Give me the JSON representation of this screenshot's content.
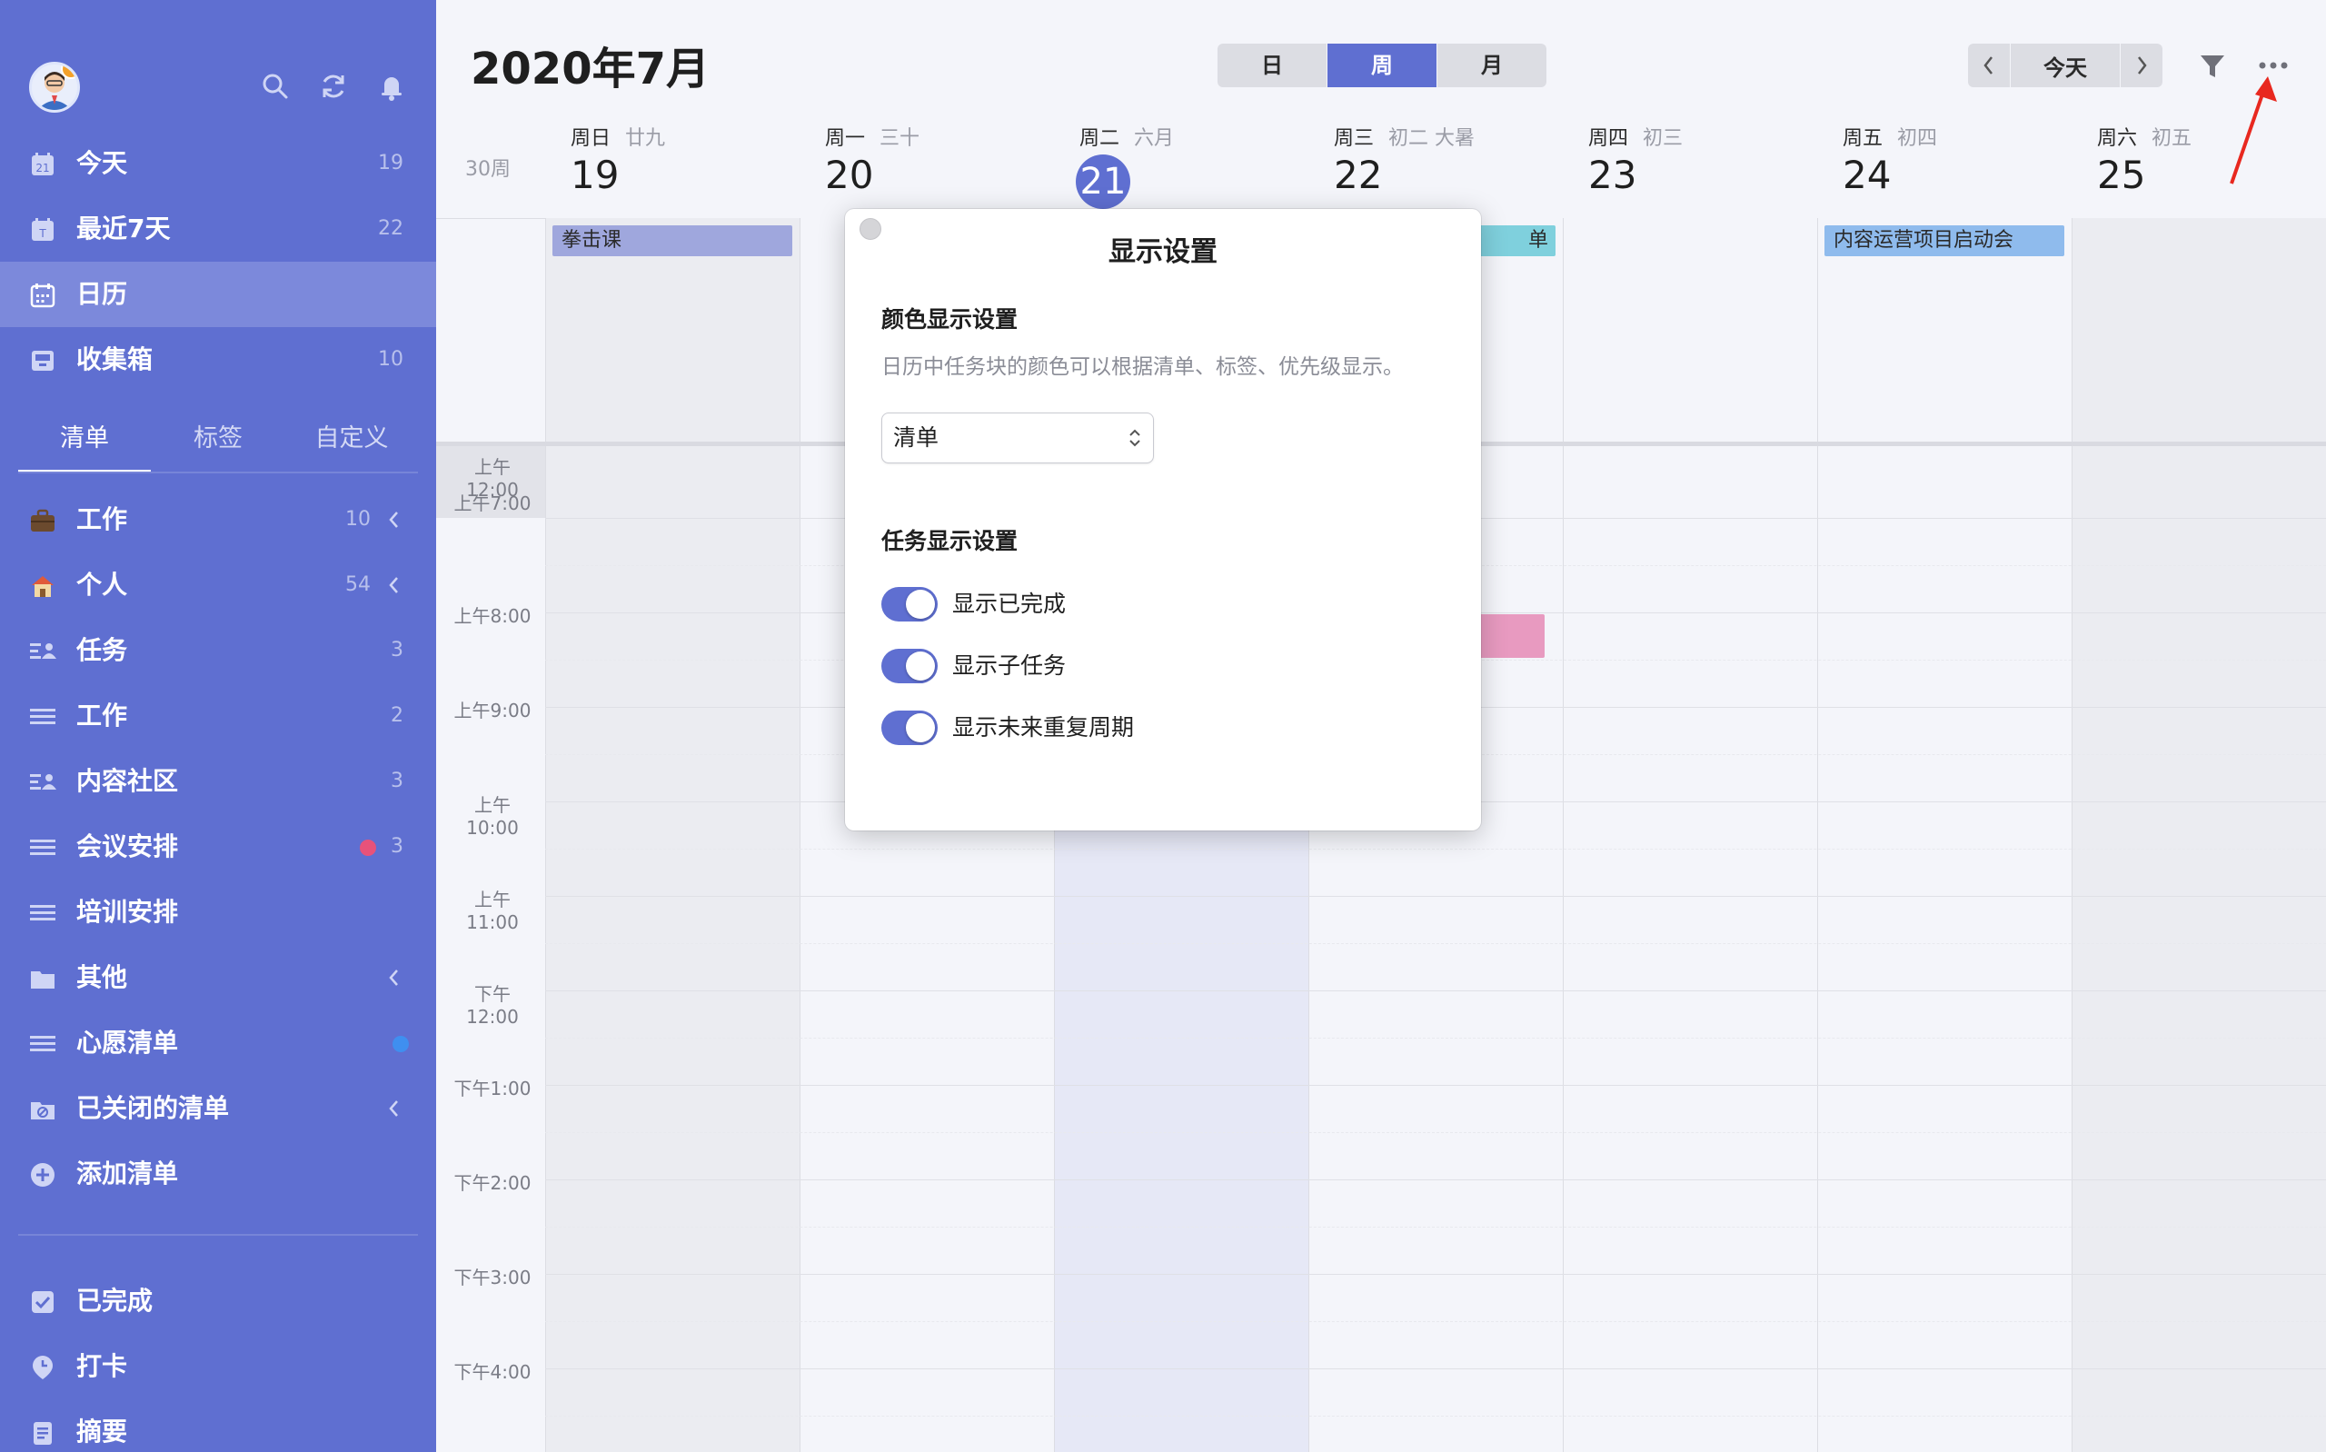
{
  "header": {
    "title": "2020年7月",
    "views": [
      "日",
      "周",
      "月"
    ],
    "active_view": "周",
    "today_label": "今天"
  },
  "sidebar": {
    "smart_lists": [
      {
        "label": "今天",
        "count": "19"
      },
      {
        "label": "最近7天",
        "count": "22"
      },
      {
        "label": "日历",
        "count": ""
      },
      {
        "label": "收集箱",
        "count": "10"
      }
    ],
    "tabs": [
      "清单",
      "标签",
      "自定义"
    ],
    "lists": [
      {
        "label": "工作",
        "count": "10"
      },
      {
        "label": "个人",
        "count": "54"
      },
      {
        "label": "任务",
        "count": "3"
      },
      {
        "label": "工作",
        "count": "2"
      },
      {
        "label": "内容社区",
        "count": "3"
      },
      {
        "label": "会议安排",
        "count": "3"
      },
      {
        "label": "培训安排",
        "count": ""
      },
      {
        "label": "其他",
        "count": ""
      },
      {
        "label": "心愿清单",
        "count": ""
      },
      {
        "label": "已关闭的清单",
        "count": ""
      },
      {
        "label": "添加清单",
        "count": ""
      }
    ],
    "bottom": [
      {
        "label": "已完成"
      },
      {
        "label": "打卡"
      },
      {
        "label": "摘要"
      }
    ],
    "colors": {
      "background": "#5f6fd1",
      "active": "#7c89db",
      "red_dot": "#e8527a",
      "blue_dot": "#3f8ff0"
    }
  },
  "calendar": {
    "week_label": "30周",
    "days": [
      {
        "dow": "周日",
        "lunar": "廿九",
        "num": "19"
      },
      {
        "dow": "周一",
        "lunar": "三十",
        "num": "20"
      },
      {
        "dow": "周二",
        "lunar": "六月",
        "num": "21"
      },
      {
        "dow": "周三",
        "lunar": "初二  大暑",
        "num": "22"
      },
      {
        "dow": "周四",
        "lunar": "初三",
        "num": "23"
      },
      {
        "dow": "周五",
        "lunar": "初四",
        "num": "24"
      },
      {
        "dow": "周六",
        "lunar": "初五",
        "num": "25"
      }
    ],
    "times": [
      "上午12:00",
      "上午7:00",
      "上午8:00",
      "上午9:00",
      "上午10:00",
      "上午11:00",
      "下午12:00",
      "下午1:00",
      "下午2:00",
      "下午3:00",
      "下午4:00"
    ],
    "events": [
      {
        "title": "拳击课",
        "color": "#9fa7dd"
      },
      {
        "title": "单",
        "color": "#7fd0dd"
      },
      {
        "title": "内容运营项目启动会",
        "color": "#8fbbed"
      },
      {
        "title": "",
        "color": "#e89ac0"
      }
    ]
  },
  "dialog": {
    "title": "显示设置",
    "color_section": "颜色显示设置",
    "color_desc": "日历中任务块的颜色可以根据清单、标签、优先级显示。",
    "color_select_value": "清单",
    "task_section": "任务显示设置",
    "toggles": [
      {
        "label": "显示已完成",
        "on": true
      },
      {
        "label": "显示子任务",
        "on": true
      },
      {
        "label": "显示未来重复周期",
        "on": true
      }
    ]
  }
}
